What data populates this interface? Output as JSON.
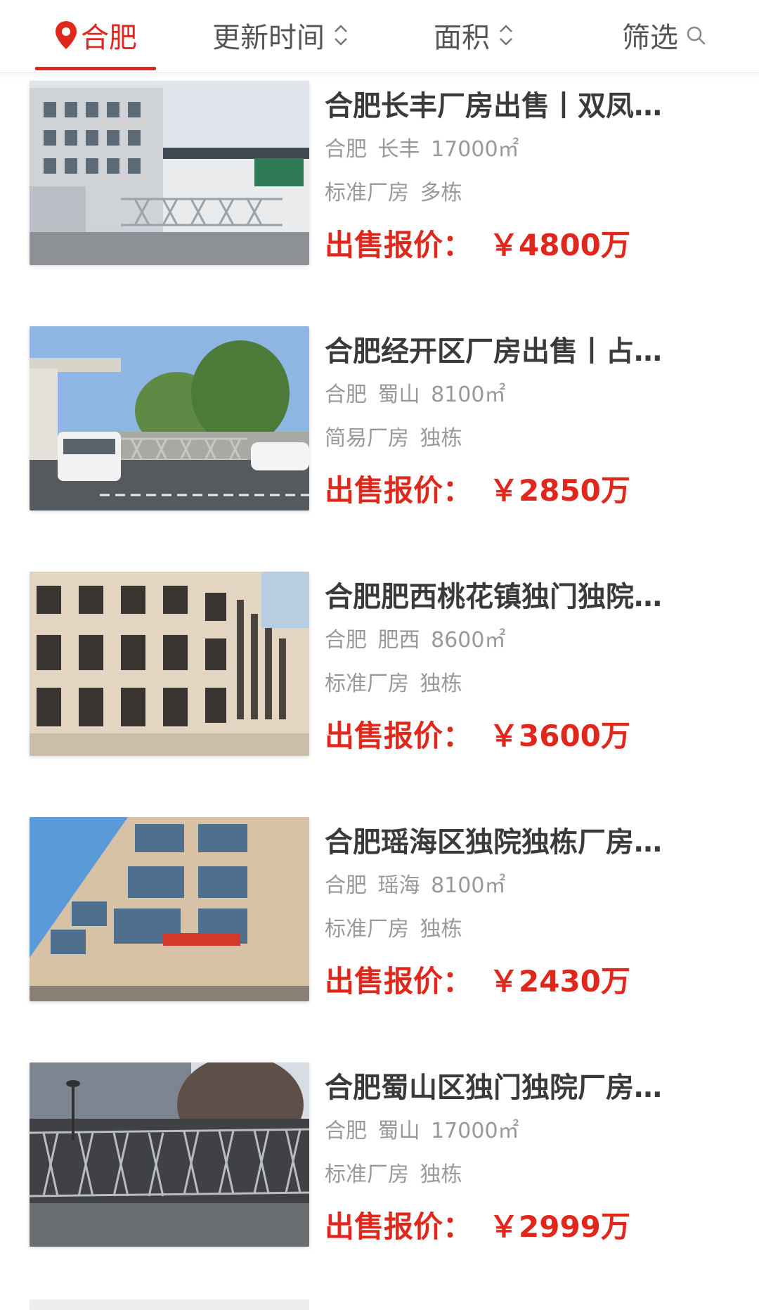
{
  "filter_bar": {
    "city": "合肥",
    "sort_time": "更新时间",
    "sort_area": "面积",
    "screen": "筛选",
    "icons": {
      "city": "location-pin-icon",
      "time": "sort-updown-icon",
      "area": "sort-updown-icon",
      "screen": "search-icon"
    },
    "accent_color": "#e0271c"
  },
  "listings": [
    {
      "title": "合肥长丰厂房出售丨双凤…",
      "city": "合肥",
      "district": "长丰",
      "area": "17000㎡",
      "type": "标准厂房",
      "building": "多栋",
      "price_label": "出售报价：",
      "price": "￥4800万"
    },
    {
      "title": "合肥经开区厂房出售丨占…",
      "city": "合肥",
      "district": "蜀山",
      "area": "8100㎡",
      "type": "简易厂房",
      "building": "独栋",
      "price_label": "出售报价：",
      "price": "￥2850万"
    },
    {
      "title": "合肥肥西桃花镇独门独院…",
      "city": "合肥",
      "district": "肥西",
      "area": "8600㎡",
      "type": "标准厂房",
      "building": "独栋",
      "price_label": "出售报价：",
      "price": "￥3600万"
    },
    {
      "title": "合肥瑶海区独院独栋厂房…",
      "city": "合肥",
      "district": "瑶海",
      "area": "8100㎡",
      "type": "标准厂房",
      "building": "独栋",
      "price_label": "出售报价：",
      "price": "￥2430万"
    },
    {
      "title": "合肥蜀山区独门独院厂房…",
      "city": "合肥",
      "district": "蜀山",
      "area": "17000㎡",
      "type": "标准厂房",
      "building": "独栋",
      "price_label": "出售报价：",
      "price": "￥2999万"
    }
  ]
}
